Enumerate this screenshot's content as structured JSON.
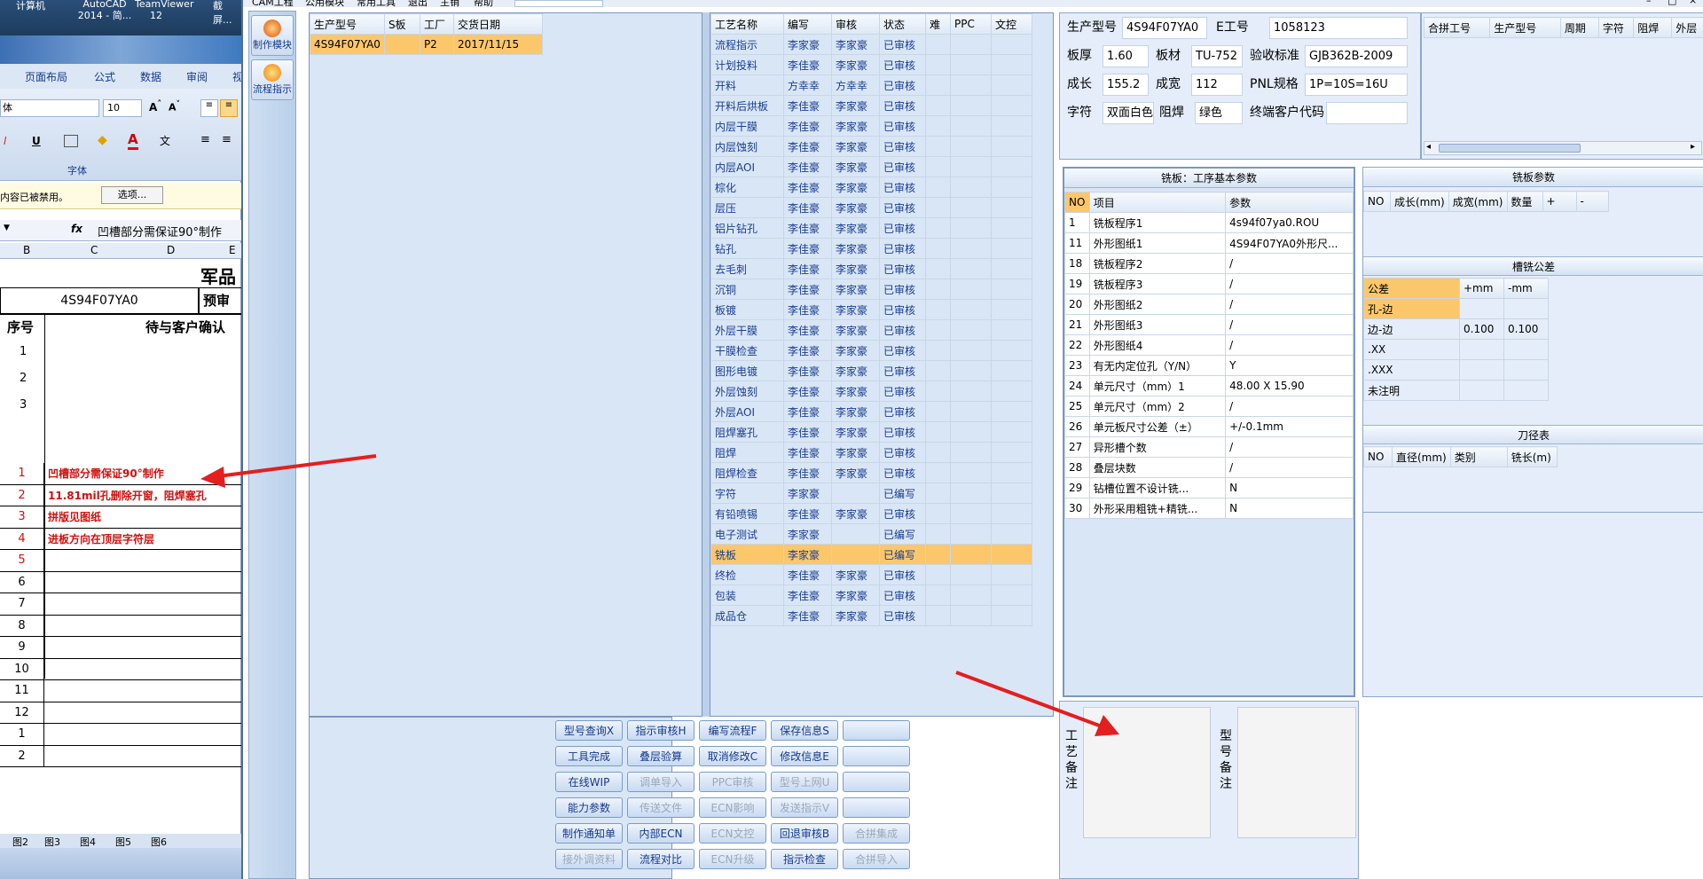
{
  "taskbar": {
    "items": [
      "计算机",
      "AutoCAD 2014 - 简...",
      "TeamViewer 12",
      "截屏..."
    ]
  },
  "excel": {
    "ribbon_tabs": [
      "页面布局",
      "公式",
      "数据",
      "审阅",
      "视"
    ],
    "font_name": "体",
    "font_size": "10",
    "font_group_label": "字体",
    "security_msg": "内容已被禁用。",
    "options_btn": "选项...",
    "fx": "fx",
    "formula": "凹槽部分需保证90°制作",
    "columns": [
      "B",
      "C",
      "D",
      "E"
    ],
    "title": "军品",
    "part_no": "4S94F07YA0",
    "pre_review": "预审",
    "col_seq": "序号",
    "col_confirm": "待与客户确认",
    "rows_top": [
      "1",
      "2",
      "3"
    ],
    "rows": [
      {
        "n": "1",
        "t": "凹槽部分需保证90°制作"
      },
      {
        "n": "2",
        "t": "11.81mil孔删除开窗，阻焊塞孔"
      },
      {
        "n": "3",
        "t": "拼版见图纸"
      },
      {
        "n": "4",
        "t": "进板方向在顶层字符层"
      },
      {
        "n": "5",
        "t": ""
      },
      {
        "n": "6",
        "t": ""
      },
      {
        "n": "7",
        "t": ""
      },
      {
        "n": "8",
        "t": ""
      },
      {
        "n": "9",
        "t": ""
      },
      {
        "n": "10",
        "t": ""
      },
      {
        "n": "11",
        "t": ""
      },
      {
        "n": "12",
        "t": ""
      },
      {
        "n": "1",
        "t": ""
      },
      {
        "n": "2",
        "t": ""
      }
    ],
    "sheet_tabs": [
      "图2",
      "图3",
      "图4",
      "图5",
      "图6"
    ]
  },
  "app": {
    "menu": [
      "CAM工程",
      "公用模块",
      "常用工具",
      "退出",
      "主销",
      "帮助"
    ],
    "side_buttons": [
      "制作模块",
      "流程指示"
    ],
    "jobs": {
      "headers": [
        "生产型号",
        "S板",
        "工厂",
        "交货日期"
      ],
      "rows": [
        [
          "4S94F07YA0",
          "",
          "P2",
          "2017/11/15"
        ]
      ]
    },
    "process": {
      "headers": [
        "工艺名称",
        "编写",
        "审核",
        "状态",
        "难",
        "PPC",
        "文控"
      ],
      "rows": [
        [
          "流程指示",
          "李家豪",
          "李家豪",
          "已审核"
        ],
        [
          "计划投料",
          "李佳豪",
          "李家豪",
          "已审核"
        ],
        [
          "开料",
          "方幸幸",
          "方幸幸",
          "已审核"
        ],
        [
          "开料后烘板",
          "李佳豪",
          "李家豪",
          "已审核"
        ],
        [
          "内层干膜",
          "李佳豪",
          "李家豪",
          "已审核"
        ],
        [
          "内层蚀刻",
          "李佳豪",
          "李家豪",
          "已审核"
        ],
        [
          "内层AOI",
          "李佳豪",
          "李家豪",
          "已审核"
        ],
        [
          "棕化",
          "李佳豪",
          "李家豪",
          "已审核"
        ],
        [
          "层压",
          "李佳豪",
          "李家豪",
          "已审核"
        ],
        [
          "铝片钻孔",
          "李佳豪",
          "李家豪",
          "已审核"
        ],
        [
          "钻孔",
          "李佳豪",
          "李家豪",
          "已审核"
        ],
        [
          "去毛刺",
          "李佳豪",
          "李家豪",
          "已审核"
        ],
        [
          "沉铜",
          "李佳豪",
          "李家豪",
          "已审核"
        ],
        [
          "板镀",
          "李佳豪",
          "李家豪",
          "已审核"
        ],
        [
          "外层干膜",
          "李佳豪",
          "李家豪",
          "已审核"
        ],
        [
          "干膜检查",
          "李佳豪",
          "李家豪",
          "已审核"
        ],
        [
          "图形电镀",
          "李佳豪",
          "李家豪",
          "已审核"
        ],
        [
          "外层蚀刻",
          "李佳豪",
          "李家豪",
          "已审核"
        ],
        [
          "外层AOI",
          "李佳豪",
          "李家豪",
          "已审核"
        ],
        [
          "阻焊塞孔",
          "李佳豪",
          "李家豪",
          "已审核"
        ],
        [
          "阻焊",
          "李佳豪",
          "李家豪",
          "已审核"
        ],
        [
          "阻焊检查",
          "李佳豪",
          "李家豪",
          "已审核"
        ],
        [
          "字符",
          "李家豪",
          "",
          "已编写"
        ],
        [
          "有铅喷锡",
          "李佳豪",
          "李家豪",
          "已审核"
        ],
        [
          "电子测试",
          "李家豪",
          "",
          "已编写"
        ],
        [
          "铣板",
          "李家豪",
          "",
          "已编写"
        ],
        [
          "终检",
          "李佳豪",
          "李家豪",
          "已审核"
        ],
        [
          "包装",
          "李佳豪",
          "李家豪",
          "已审核"
        ],
        [
          "成品仓",
          "李佳豪",
          "李家豪",
          "已审核"
        ]
      ],
      "selected_index": 25
    },
    "buttons": [
      [
        "型号查询X",
        "指示审核H",
        "编写流程F",
        "保存信息S",
        ""
      ],
      [
        "工具完成",
        "叠层验算",
        "取消修改C",
        "修改信息E",
        ""
      ],
      [
        "在线WIP",
        "调单导入",
        "PPC审核",
        "型号上网U",
        ""
      ],
      [
        "能力参数",
        "传送文件",
        "ECN影响",
        "发送指示V",
        ""
      ],
      [
        "制作通知单",
        "内部ECN",
        "ECN文控",
        "回退审核B",
        "合拼集成"
      ],
      [
        "接外调资料",
        "流程对比",
        "ECN升级",
        "指示检查",
        "合拼导入"
      ]
    ],
    "buttons_disabled": [
      [
        false,
        false,
        false,
        false,
        false
      ],
      [
        false,
        false,
        false,
        false,
        false
      ],
      [
        false,
        true,
        true,
        true,
        false
      ],
      [
        false,
        true,
        true,
        true,
        false
      ],
      [
        false,
        false,
        true,
        false,
        true
      ],
      [
        true,
        false,
        true,
        false,
        true
      ]
    ],
    "info": {
      "part_label": "生产型号",
      "part": "4S94F07YA0",
      "eno_label": "E工号",
      "eno": "1058123",
      "thick_label": "板厚",
      "thick": "1.60",
      "mat_label": "板材",
      "mat": "TU-752",
      "std_label": "验收标准",
      "std": "GJB362B-2009",
      "len_label": "成长",
      "len": "155.2",
      "wid_label": "成宽",
      "wid": "112",
      "pnl_label": "PNL规格",
      "pnl": "1P=10S=16U",
      "char_label": "字符",
      "char": "双面白色",
      "mask_label": "阻焊",
      "mask": "绿色",
      "cust_label": "终端客户代码",
      "cust": ""
    },
    "merge_headers": [
      "合拼工号",
      "生产型号",
      "周期",
      "字符",
      "阻焊",
      "外层"
    ],
    "mill": {
      "title": "铣板：工序基本参数",
      "headers": [
        "NO",
        "项目",
        "参数"
      ],
      "rows": [
        [
          "1",
          "铣板程序1",
          "4s94f07ya0.ROU"
        ],
        [
          "11",
          "外形图纸1",
          "4S94F07YA0外形尺..."
        ],
        [
          "18",
          "铣板程序2",
          "/"
        ],
        [
          "19",
          "铣板程序3",
          "/"
        ],
        [
          "20",
          "外形图纸2",
          "/"
        ],
        [
          "21",
          "外形图纸3",
          "/"
        ],
        [
          "22",
          "外形图纸4",
          "/"
        ],
        [
          "23",
          "有无内定位孔（Y/N）",
          "Y"
        ],
        [
          "24",
          "单元尺寸（mm）1",
          "48.00 X 15.90"
        ],
        [
          "25",
          "单元尺寸（mm）2",
          "/"
        ],
        [
          "26",
          "单元板尺寸公差（±）",
          "+/-0.1mm"
        ],
        [
          "27",
          "异形槽个数",
          "/"
        ],
        [
          "28",
          "叠层块数",
          "/"
        ],
        [
          "29",
          "钻槽位置不设计铣...",
          "N"
        ],
        [
          "30",
          "外形采用粗铣+精铣...",
          "N"
        ]
      ]
    },
    "mill_params": {
      "title": "铣板参数",
      "headers": [
        "NO",
        "成长(mm)",
        "成宽(mm)",
        "数量",
        "+",
        "-"
      ]
    },
    "slot_tol": {
      "title": "槽铣公差",
      "headers": [
        "公差",
        "+mm",
        "-mm"
      ],
      "rows": [
        [
          "孔-边",
          "",
          ""
        ],
        [
          "边-边",
          "0.100",
          "0.100"
        ],
        [
          ".XX",
          "",
          ""
        ],
        [
          ".XXX",
          "",
          ""
        ],
        [
          "未注明",
          "",
          ""
        ]
      ]
    },
    "tools": {
      "title": "刀径表",
      "headers": [
        "NO",
        "直径(mm)",
        "类别",
        "铣长(m)"
      ]
    },
    "notes": {
      "process_label": "工艺备注",
      "model_label": "型号备注"
    }
  },
  "colors": {
    "accent": "#fbc76a",
    "panel": "#d9e6f6",
    "red": "#e31f1f"
  }
}
